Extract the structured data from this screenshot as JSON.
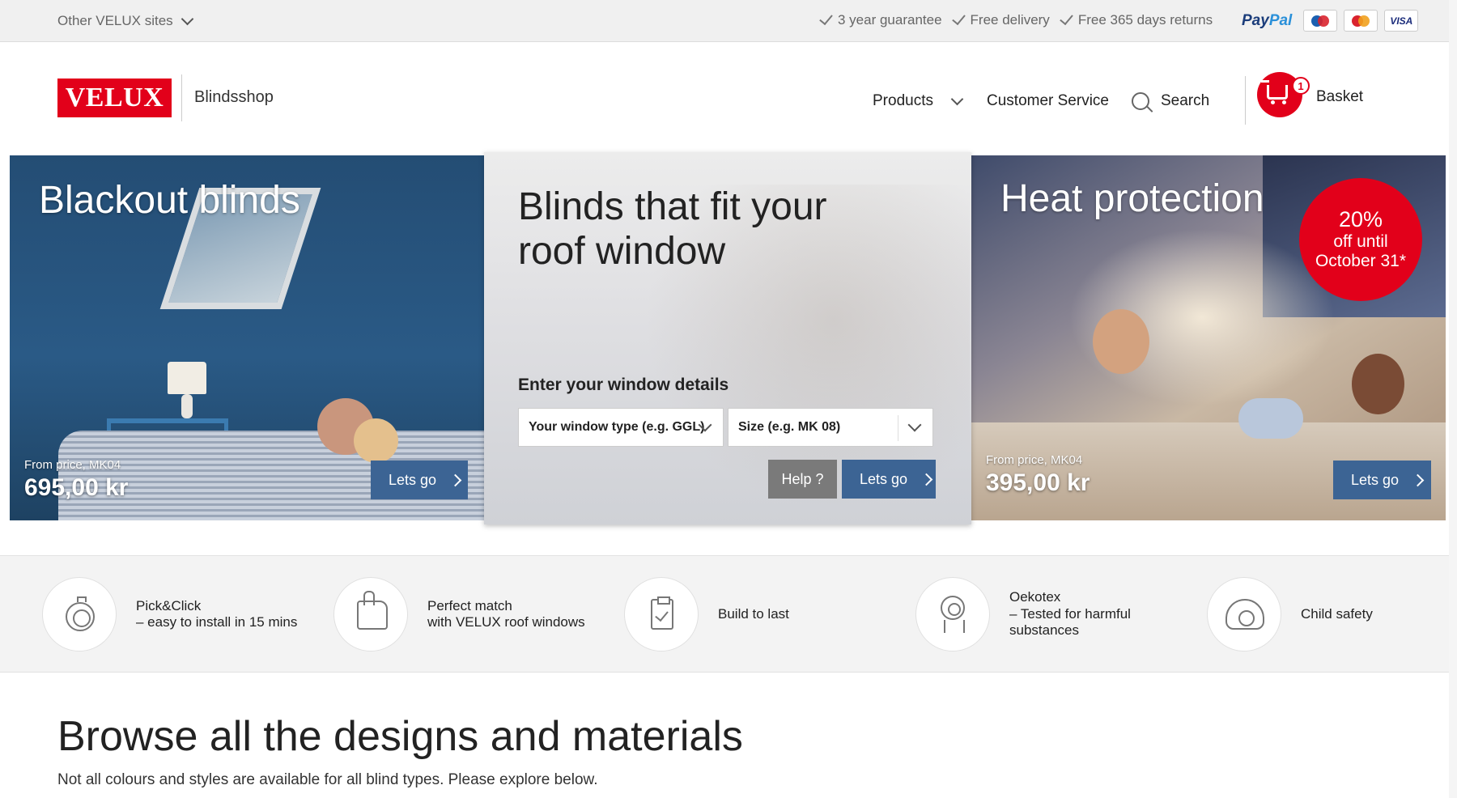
{
  "topbar": {
    "other_sites": "Other VELUX sites",
    "usps": [
      "3 year guarantee",
      "Free delivery",
      "Free 365 days returns"
    ],
    "paypal_p": "Pay",
    "paypal_pal": "Pal",
    "cards": [
      "Maestro",
      "MasterCard",
      "VISA"
    ]
  },
  "header": {
    "logo": "VELUX",
    "shop_name": "Blindsshop",
    "nav": {
      "products": "Products",
      "customer_service": "Customer Service",
      "search": "Search"
    },
    "basket": {
      "count": "1",
      "label": "Basket"
    }
  },
  "hero": {
    "blackout": {
      "title": "Blackout blinds",
      "price_label": "From price, MK04",
      "price_value": "695,00 kr",
      "cta": "Lets go"
    },
    "center": {
      "title": "Blinds that fit your roof window",
      "subtitle": "Enter your window details",
      "type_select": "Your window type (e.g. GGL)",
      "size_select": "Size (e.g. MK 08)",
      "help": "Help ?",
      "cta": "Lets go"
    },
    "heat": {
      "title": "Heat protection",
      "promo_pct": "20%",
      "promo_line1": "off until",
      "promo_line2": "October 31*",
      "price_label": "From price, MK04",
      "price_value": "395,00 kr",
      "cta": "Lets go"
    }
  },
  "features": [
    {
      "line1": "Pick&Click",
      "line2": "– easy to install in 15 mins",
      "icon": "stopwatch-icon"
    },
    {
      "line1": "Perfect match",
      "line2": "with VELUX roof windows",
      "icon": "thumbs-up-icon"
    },
    {
      "line1": "Build to last",
      "line2": "",
      "icon": "clipboard-check-icon"
    },
    {
      "line1": "Oekotex",
      "line2": "– Tested for harmful",
      "line3": "substances",
      "icon": "award-icon"
    },
    {
      "line1": "Child safety",
      "line2": "",
      "icon": "child-icon"
    }
  ],
  "browse": {
    "title": "Browse all the designs and materials",
    "subtitle": "Not all colours and styles are available for all blind types. Please explore below."
  },
  "colors": {
    "brand_red": "#e2001a",
    "button_blue": "#3c6494",
    "help_gray": "#7a7a7a"
  }
}
